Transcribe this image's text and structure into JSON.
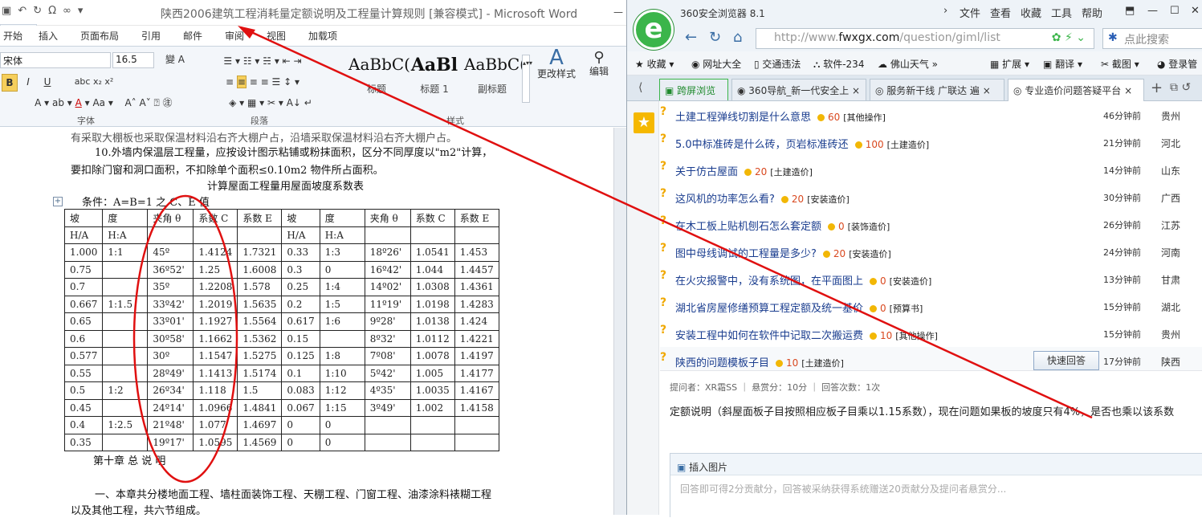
{
  "word": {
    "title": "陕西2006建筑工程消耗量定额说明及工程量计算规则 [兼容模式] - Microsoft Word",
    "tabs": [
      "开始",
      "插入",
      "页面布局",
      "引用",
      "邮件",
      "审阅",
      "视图",
      "加载项"
    ],
    "font_name": "宋体",
    "font_size": "16.5",
    "styles": [
      {
        "preview": "AaBbC(",
        "name": "标题"
      },
      {
        "preview": "AaBl",
        "name": "标题 1"
      },
      {
        "preview": "AaBbC(",
        "name": "副标题"
      }
    ],
    "change_styles": "更改样式",
    "edit": "编辑",
    "groups": {
      "font": "字体",
      "paragraph": "段落",
      "styles": "样式"
    },
    "doc": {
      "line0": "有采取大棚板也采取保温材料沿右齐大棚户占，沿墙采取保温材料沿右齐大棚户占。",
      "para10_a": "10.外墙内保温层工程量，应按设计图示粘铺或粉抹面积，区分不同厚度以\"m2\"计算，",
      "para10_b": "要扣除门窗和洞口面积，不扣除单个面积≤0.10m2 物件所占面积。",
      "table_title": "计算屋面工程量用屋面坡度系数表",
      "condition": "条件：A=B=1 之 C、E 值",
      "table_header1": [
        "坡",
        "度",
        "夹角 θ",
        "系数 C",
        "系数 E",
        "坡",
        "度",
        "夹角 θ",
        "系数 C",
        "系数 E"
      ],
      "table_header2": [
        "H/A",
        "H:A",
        "",
        "",
        "",
        "H/A",
        "H:A",
        "",
        "",
        ""
      ],
      "table_rows": [
        [
          "1.000",
          "1:1",
          "45º",
          "1.4124",
          "1.7321",
          "0.33",
          "1:3",
          "18º26'",
          "1.0541",
          "1.453"
        ],
        [
          "0.75",
          "",
          "36º52'",
          "1.25",
          "1.6008",
          "0.3",
          "0",
          "16º42'",
          "1.044",
          "1.4457"
        ],
        [
          "0.7",
          "",
          "35º",
          "1.2208",
          "1.578",
          "0.25",
          "1:4",
          "14º02'",
          "1.0308",
          "1.4361"
        ],
        [
          "0.667",
          "1:1.5",
          "33º42'",
          "1.2019",
          "1.5635",
          "0.2",
          "1:5",
          "11º19'",
          "1.0198",
          "1.4283"
        ],
        [
          "0.65",
          "",
          "33º01'",
          "1.1927",
          "1.5564",
          "0.617",
          "1:6",
          "9º28'",
          "1.0138",
          "1.424"
        ],
        [
          "0.6",
          "",
          "30º58'",
          "1.1662",
          "1.5362",
          "0.15",
          "",
          "8º32'",
          "1.0112",
          "1.4221"
        ],
        [
          "0.577",
          "",
          "30º",
          "1.1547",
          "1.5275",
          "0.125",
          "1:8",
          "7º08'",
          "1.0078",
          "1.4197"
        ],
        [
          "0.55",
          "",
          "28º49'",
          "1.1413",
          "1.5174",
          "0.1",
          "1:10",
          "5º42'",
          "1.005",
          "1.4177"
        ],
        [
          "0.5",
          "1:2",
          "26º34'",
          "1.118",
          "1.5",
          "0.083",
          "1:12",
          "4º35'",
          "1.0035",
          "1.4167"
        ],
        [
          "0.45",
          "",
          "24º14'",
          "1.0966",
          "1.4841",
          "0.067",
          "1:15",
          "3º49'",
          "1.002",
          "1.4158"
        ],
        [
          "0.4",
          "1:2.5",
          "21º48'",
          "1.077",
          "1.4697",
          "0",
          "0",
          "",
          "",
          ""
        ],
        [
          "0.35",
          "",
          "19º17'",
          "1.0595",
          "1.4569",
          "0",
          "0",
          "",
          "",
          ""
        ]
      ],
      "chapter": "第十章 总 说 明",
      "para1_a": "一、本章共分楼地面工程、墙柱面装饰工程、天棚工程、门窗工程、油漆涂料裱糊工程",
      "para1_b": "以及其他工程，共六节组成。"
    }
  },
  "browser": {
    "name": "360安全浏览器 8.1",
    "menu": [
      "文件",
      "查看",
      "收藏",
      "工具",
      "帮助"
    ],
    "url_prefix": "http://www.",
    "url_host": "fwxgx.com",
    "url_path": "/question/giml/list",
    "search_placeholder": "点此搜索",
    "favorites": [
      "收藏",
      "网址大全",
      "交通违法",
      "软件-234",
      "佛山天气",
      "扩展",
      "翻译",
      "截图",
      "登录管"
    ],
    "tabs": [
      "跨屏浏览",
      "360导航_新一代安全上",
      "服务新干线 广联达 遍",
      "专业造价问题答疑平台"
    ],
    "questions": [
      {
        "title": "土建工程弹线切割是什么意思",
        "points": "60",
        "cat": "[其他操作]",
        "time": "46分钟前",
        "loc": "贵州"
      },
      {
        "title": "5.0中标准砖是什么砖，页岩标准砖还",
        "points": "100",
        "cat": "[土建造价]",
        "time": "21分钟前",
        "loc": "河北"
      },
      {
        "title": "关于仿古屋面",
        "points": "20",
        "cat": "[土建造价]",
        "time": "14分钟前",
        "loc": "山东"
      },
      {
        "title": "这风机的功率怎么看?",
        "points": "20",
        "cat": "[安装造价]",
        "time": "30分钟前",
        "loc": "广西"
      },
      {
        "title": "在木工板上贴机刨石怎么套定额",
        "points": "0",
        "cat": "[装饰造价]",
        "time": "26分钟前",
        "loc": "江苏"
      },
      {
        "title": "图中母线调试的工程量是多少?",
        "points": "20",
        "cat": "[安装造价]",
        "time": "24分钟前",
        "loc": "河南"
      },
      {
        "title": "在火灾报警中，没有系统图，在平面图上",
        "points": "0",
        "cat": "[安装造价]",
        "time": "13分钟前",
        "loc": "甘肃"
      },
      {
        "title": "湖北省房屋修缮预算工程定额及统一基价",
        "points": "0",
        "cat": "[预算书]",
        "time": "15分钟前",
        "loc": "湖北"
      },
      {
        "title": "安装工程中如何在软件中记取二次搬运费",
        "points": "10",
        "cat": "[其他操作]",
        "time": "15分钟前",
        "loc": "贵州"
      },
      {
        "title": "陕西的问题模板子目",
        "points": "10",
        "cat": "[土建造价]",
        "time": "17分钟前",
        "loc": "陕西"
      }
    ],
    "quick_answer": "快速回答",
    "meta": "提问者：XR霜SS ｜ 悬赏分：10分 ｜ 回答次数：1次",
    "question_body": "定额说明（斜屋面板子目按照相应板子目乘以1.15系数），现在问题如果板的坡度只有4%，是否也乘以该系数",
    "insert_image": "插入图片",
    "answer_placeholder": "回答即可得2分贡献分，回答被采纳获得系统赠送20贡献分及提问者悬赏分..."
  }
}
